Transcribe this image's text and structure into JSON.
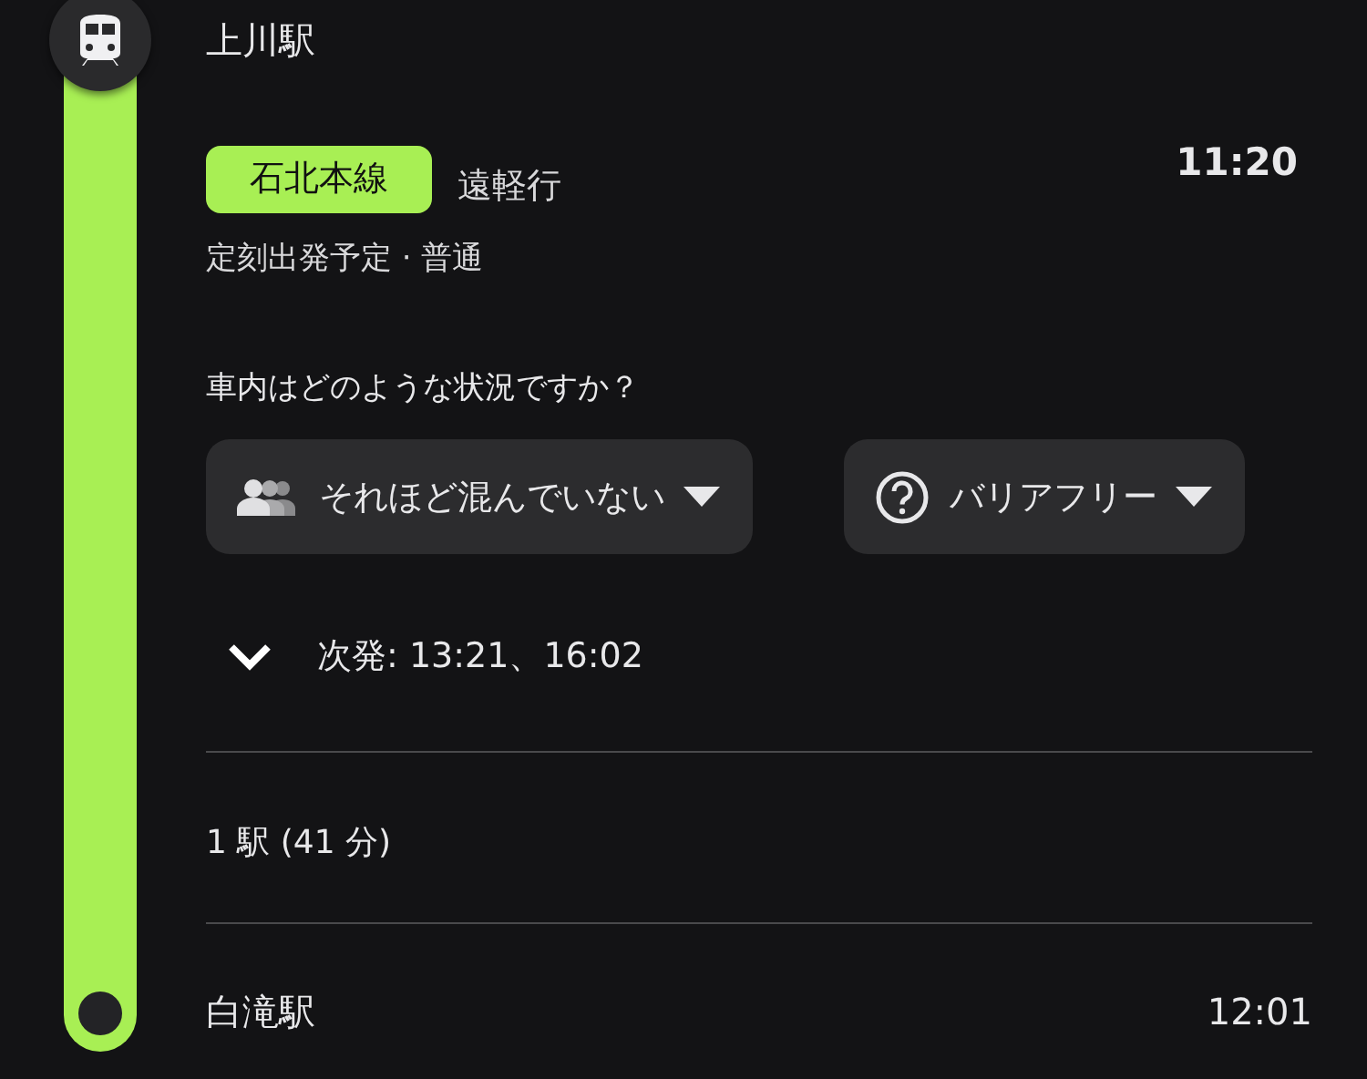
{
  "origin": {
    "station": "上川駅"
  },
  "departure": {
    "line": "石北本線",
    "destination": "遠軽行",
    "time": "11:20",
    "status": "定刻出発予定 · 普通"
  },
  "crowding": {
    "question": "車内はどのような状況ですか？",
    "dropdowns": [
      {
        "kind": "crowd",
        "label": "それほど混んでいない"
      },
      {
        "kind": "accessibility",
        "label": "バリアフリー"
      }
    ]
  },
  "next": {
    "text": "次発: 13:21、16:02",
    "expanded": false
  },
  "stops": {
    "summary": "1 駅 (41 分)"
  },
  "destination": {
    "station": "白滝駅",
    "time": "12:01"
  }
}
